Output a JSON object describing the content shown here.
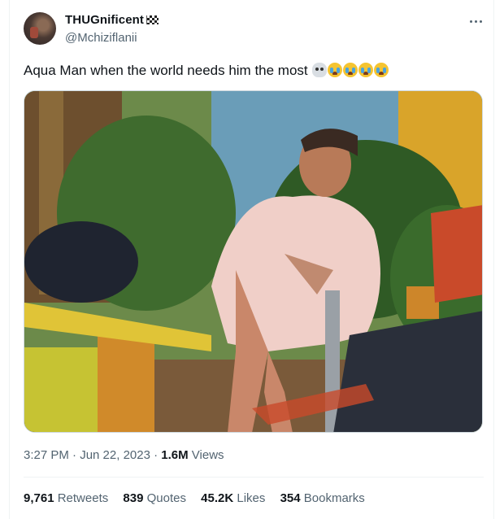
{
  "tweet": {
    "author": {
      "name": "THUGnificent",
      "handle": "@Mchiziflanii"
    },
    "text": "Aqua Man when the world needs him the most",
    "emojis": [
      "skull-emoji",
      "loudly-crying-face",
      "loudly-crying-face",
      "loudly-crying-face",
      "loudly-crying-face"
    ],
    "timestamp": "3:27 PM · Jun 22, 2023 · ",
    "views_count": "1.6M",
    "views_label": " Views",
    "stats": {
      "retweets": {
        "count": "9,761",
        "label": "Retweets"
      },
      "quotes": {
        "count": "839",
        "label": "Quotes"
      },
      "likes": {
        "count": "45.2K",
        "label": "Likes"
      },
      "bookmarks": {
        "count": "354",
        "label": "Bookmarks"
      }
    }
  },
  "colors": {
    "text_primary": "#0f1419",
    "text_secondary": "#536471",
    "divider": "#eff3f4"
  }
}
